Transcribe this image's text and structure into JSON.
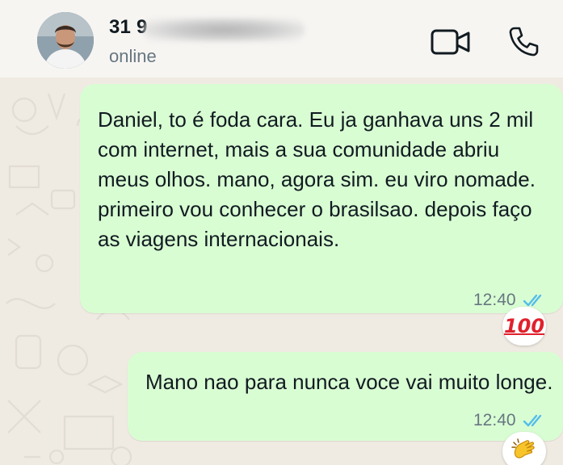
{
  "header": {
    "contact_name": "31 9",
    "status": "online",
    "icons": {
      "video": "video-camera-icon",
      "call": "phone-icon"
    }
  },
  "messages": [
    {
      "text": "Daniel, to é foda cara. Eu ja ganhava uns 2 mil com internet, mais a sua comunidade abriu meus olhos. mano, agora sim. eu viro nomade. primeiro vou conhecer o brasilsao. depois faço as viagens internacionais.",
      "time": "12:40",
      "reaction": "💯",
      "read_ticks": "double-check-icon"
    },
    {
      "text": "Mano nao para nunca voce vai muito longe.",
      "time": "12:40",
      "reaction": "👏",
      "read_ticks": "double-check-icon"
    }
  ],
  "colors": {
    "bubble": "#d9fdd3",
    "tick_read": "#53bdeb",
    "background": "#efeae2"
  }
}
